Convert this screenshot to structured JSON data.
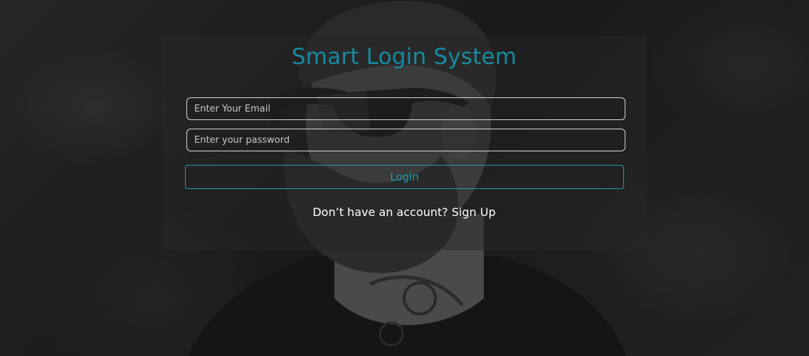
{
  "app": {
    "title": "Smart Login System"
  },
  "form": {
    "email_placeholder": "Enter Your Email",
    "email_value": "",
    "password_placeholder": "Enter your password",
    "password_value": "",
    "login_label": "Login"
  },
  "footer": {
    "prompt_text": "Don’t have an account?",
    "signup_link": "Sign Up"
  },
  "colors": {
    "accent": "#178aa0",
    "button": "#17a2b8",
    "text": "#ffffff"
  },
  "background": {
    "image": "bearded-man-portrait-grayscale"
  }
}
